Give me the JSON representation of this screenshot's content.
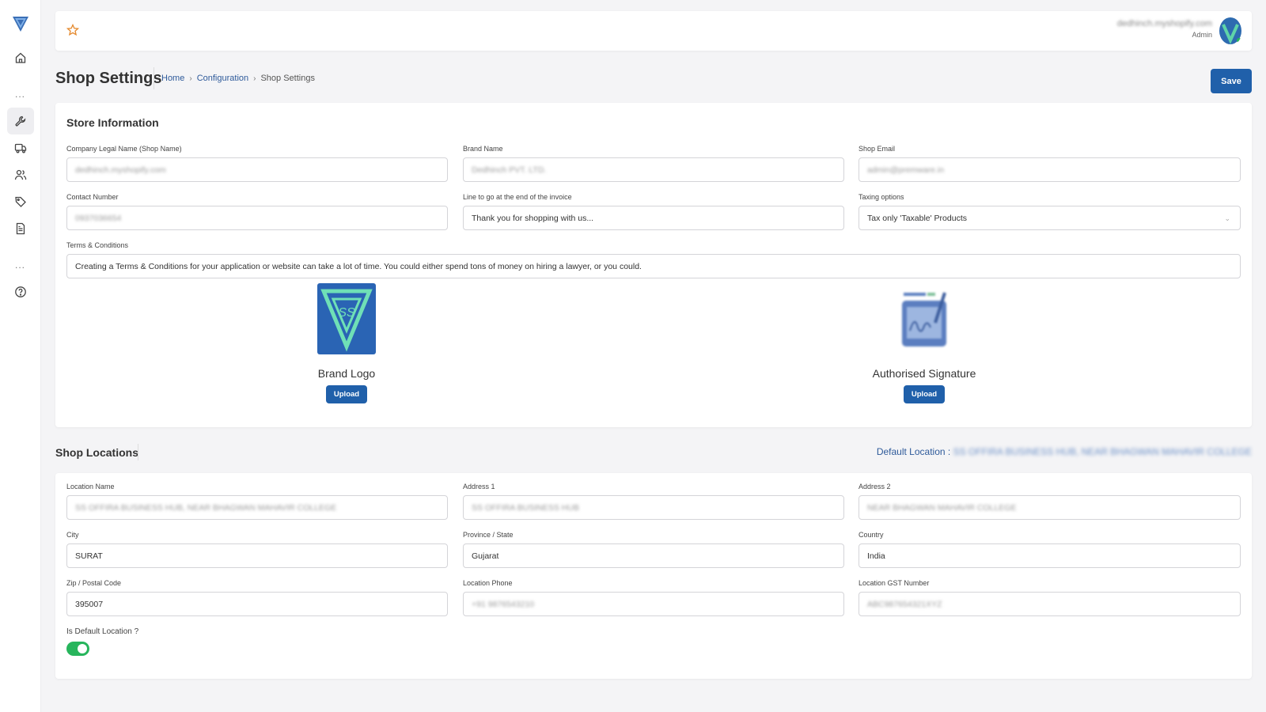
{
  "sidebar": {
    "items": [
      {
        "name": "home",
        "icon": "home-icon"
      },
      {
        "name": "more-top",
        "icon": "dots-icon"
      },
      {
        "name": "configuration",
        "icon": "wrench-icon",
        "active": true
      },
      {
        "name": "shipping",
        "icon": "truck-icon"
      },
      {
        "name": "customers",
        "icon": "users-icon"
      },
      {
        "name": "products",
        "icon": "tag-icon"
      },
      {
        "name": "invoices",
        "icon": "document-icon"
      },
      {
        "name": "more-bottom",
        "icon": "dots-icon"
      },
      {
        "name": "help",
        "icon": "help-icon"
      }
    ],
    "dots": "..."
  },
  "topbar": {
    "favorite_icon": "star-icon",
    "user_email": "dedhinch.myshopify.com",
    "user_role": "Admin"
  },
  "page": {
    "title": "Shop Settings",
    "breadcrumb": [
      {
        "label": "Home",
        "link": true
      },
      {
        "label": "Configuration",
        "link": true
      },
      {
        "label": "Shop Settings",
        "link": false
      }
    ],
    "breadcrumb_separator": "›",
    "save_label": "Save"
  },
  "store_info": {
    "title": "Store Information",
    "fields": {
      "company_name": {
        "label": "Company Legal Name (Shop Name)",
        "value": "dedhinch.myshopify.com"
      },
      "brand_name": {
        "label": "Brand Name",
        "value": "Dedhinch PVT. LTD."
      },
      "shop_email": {
        "label": "Shop Email",
        "value": "admin@premware.in"
      },
      "contact_number": {
        "label": "Contact Number",
        "value": "0937036654"
      },
      "invoice_line": {
        "label": "Line to go at the end of the invoice",
        "value": "Thank you for shopping with us..."
      },
      "taxing_options": {
        "label": "Taxing options",
        "value": "Tax only 'Taxable' Products"
      },
      "terms": {
        "label": "Terms & Conditions",
        "value": "Creating a Terms & Conditions for your application or website can take a lot of time. You could either spend tons of money on hiring a lawyer, or you could."
      }
    },
    "brand_logo": {
      "label": "Brand Logo",
      "upload_label": "Upload"
    },
    "signature": {
      "label": "Authorised Signature",
      "upload_label": "Upload"
    }
  },
  "locations": {
    "title": "Shop Locations",
    "default_label": "Default Location :",
    "default_value": "SS OFFIRA BUSINESS HUB, NEAR BHAGWAN MAHAVIR COLLEGE",
    "fields": {
      "location_name": {
        "label": "Location Name",
        "value": "SS OFFIRA BUSINESS HUB, NEAR BHAGWAN MAHAVIR COLLEGE"
      },
      "address1": {
        "label": "Address 1",
        "value": "SS OFFIRA BUSINESS HUB"
      },
      "address2": {
        "label": "Address 2",
        "value": "NEAR BHAGWAN MAHAVIR COLLEGE"
      },
      "city": {
        "label": "City",
        "value": "SURAT"
      },
      "state": {
        "label": "Province / State",
        "value": "Gujarat"
      },
      "country": {
        "label": "Country",
        "value": "India"
      },
      "zip": {
        "label": "Zip / Postal Code",
        "value": "395007"
      },
      "phone": {
        "label": "Location Phone",
        "value": "+91 9876543210"
      },
      "gst": {
        "label": "Location GST Number",
        "value": "ABC987654321XYZ"
      }
    },
    "is_default": {
      "label": "Is Default Location ?",
      "checked": true
    }
  },
  "colors": {
    "primary": "#2060aa",
    "link": "#2e5a9a",
    "toggle_on": "#27b55c",
    "star": "#e58a2e"
  }
}
